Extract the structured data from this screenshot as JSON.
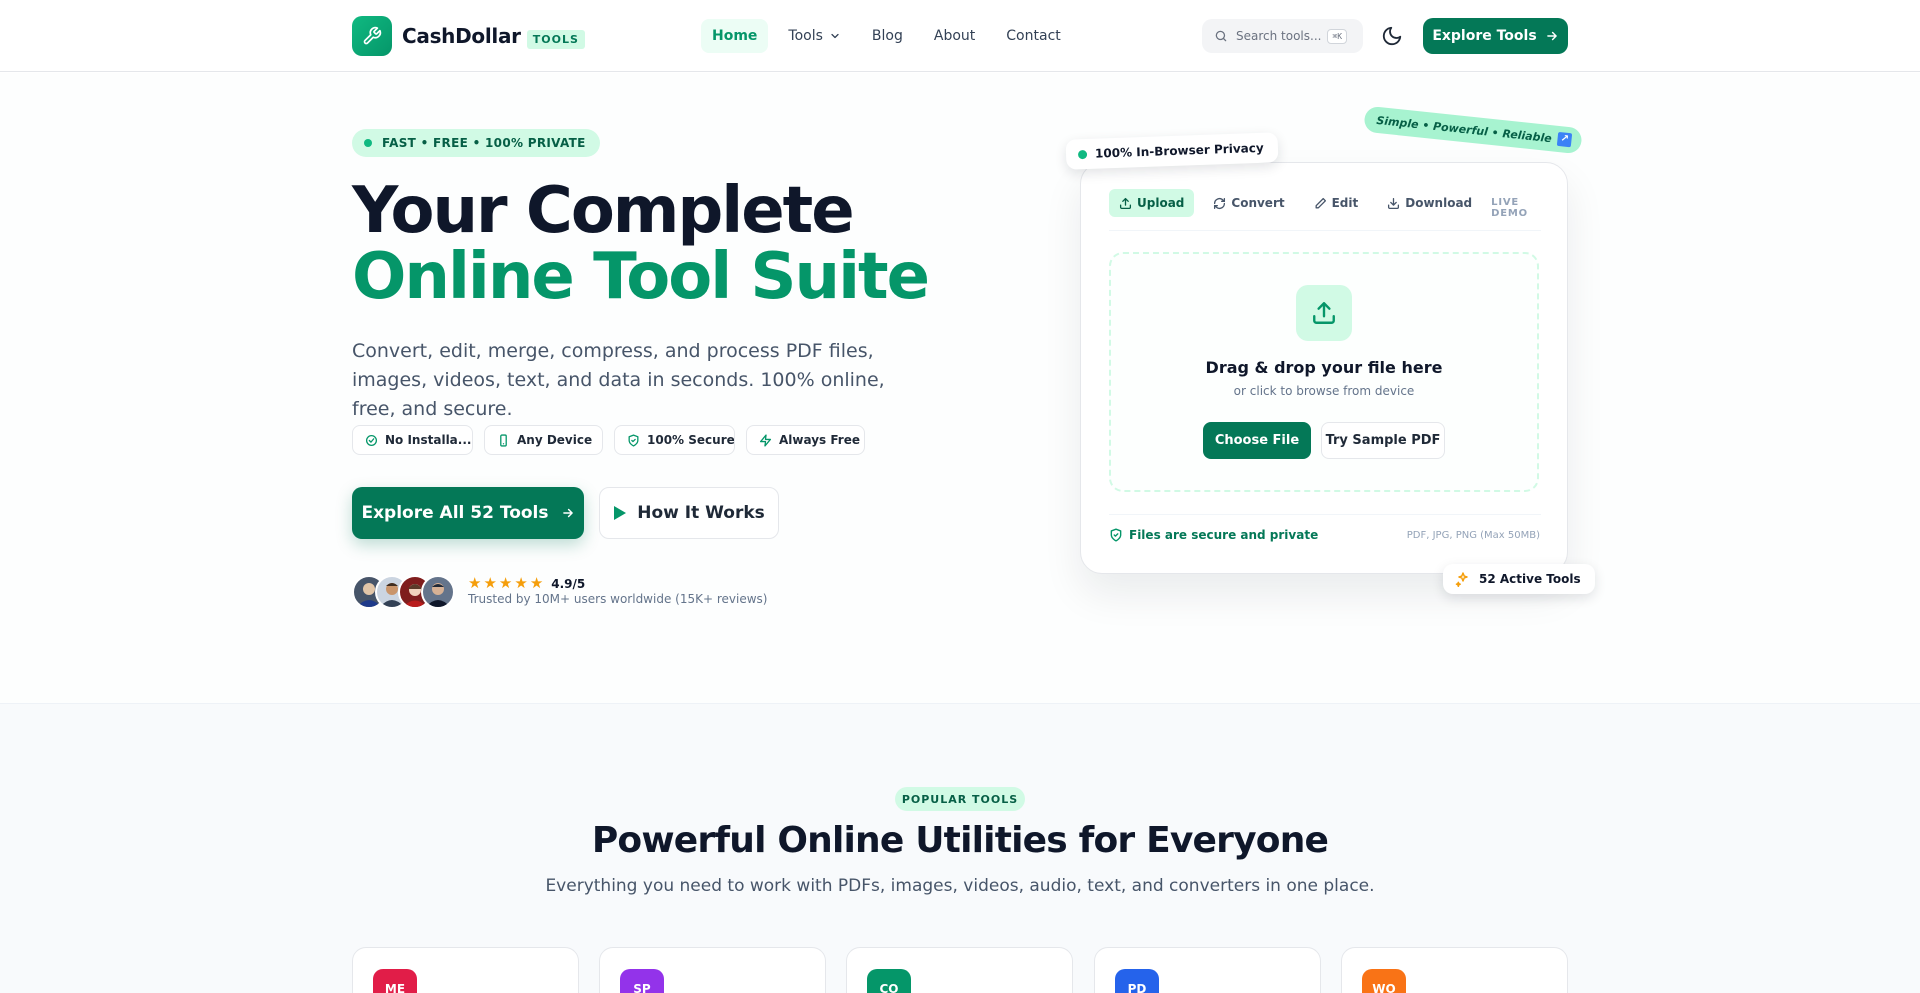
{
  "brand": {
    "name": "CashDollar",
    "tag": "TOOLS"
  },
  "nav": {
    "links": [
      {
        "label": "Home"
      },
      {
        "label": "Tools"
      },
      {
        "label": "Blog"
      },
      {
        "label": "About"
      },
      {
        "label": "Contact"
      }
    ],
    "search_placeholder": "Search tools...",
    "search_shortcut": "⌘K",
    "explore_button": "Explore Tools"
  },
  "hero": {
    "badge": "FAST • FREE • 100% PRIVATE",
    "title_line1": "Your Complete",
    "title_line2": "Online Tool Suite",
    "description": "Convert, edit, merge, compress, and process PDF files, images, videos, text, and data in seconds. 100% online, free, and secure.",
    "chips": [
      {
        "label": "No Installa..."
      },
      {
        "label": "Any Device"
      },
      {
        "label": "100% Secure"
      },
      {
        "label": "Always Free"
      }
    ],
    "primary_button": "Explore All 52 Tools",
    "secondary_button": "How It Works",
    "rating_value": "4.9/5",
    "rating_stars": 5,
    "trust_text": "Trusted by 10M+ users worldwide (15K+ reviews)"
  },
  "demo": {
    "privacy_tag": "100% In-Browser Privacy",
    "slogan_tag": "Simple • Powerful • Reliable",
    "tabs": [
      {
        "label": "Upload"
      },
      {
        "label": "Convert"
      },
      {
        "label": "Edit"
      },
      {
        "label": "Download"
      }
    ],
    "live_label": "LIVE DEMO",
    "drop_title": "Drag & drop your file here",
    "drop_sub": "or click to browse from device",
    "choose_button": "Choose File",
    "sample_button": "Try Sample PDF",
    "secure_text": "Files are secure and private",
    "formats_text": "PDF, JPG, PNG (Max 50MB)",
    "active_tools_tag": "52 Active Tools"
  },
  "popular": {
    "badge": "POPULAR TOOLS",
    "title": "Powerful Online Utilities for Everyone",
    "subtitle": "Everything you need to work with PDFs, images, videos, audio, text, and converters in one place.",
    "cards": [
      {
        "abbr": "ME",
        "color": "#e11d48"
      },
      {
        "abbr": "SP",
        "color": "#9333ea"
      },
      {
        "abbr": "CO",
        "color": "#059669"
      },
      {
        "abbr": "PD",
        "color": "#2563eb"
      },
      {
        "abbr": "WO",
        "color": "#f97316"
      }
    ]
  },
  "colors": {
    "accent": "#047857",
    "accent_light": "#d1fae5",
    "brand_green": "#059669"
  }
}
